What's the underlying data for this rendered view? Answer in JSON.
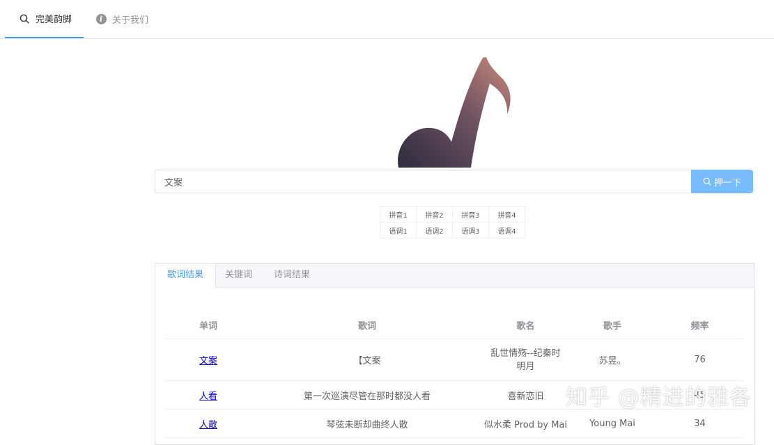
{
  "nav": {
    "items": [
      {
        "label": "完美韵脚",
        "icon": "search-icon"
      },
      {
        "label": "关于我们",
        "icon": "info-icon"
      }
    ],
    "active_index": 0,
    "accent": "#409eff"
  },
  "logo": {
    "icon": "music-note-icon"
  },
  "search": {
    "value": "文案",
    "button_label": "押一下",
    "button_color": "#79bbff"
  },
  "pinyin_grid": {
    "row1": [
      "拼音1",
      "拼音2",
      "拼音3",
      "拼音4"
    ],
    "row2": [
      "语调1",
      "语调2",
      "语调3",
      "语调4"
    ]
  },
  "tabs": [
    "歌词结果",
    "关键词",
    "诗词结果"
  ],
  "results": {
    "headers": [
      "单词",
      "歌词",
      "歌名",
      "歌手",
      "频率"
    ],
    "rows": [
      {
        "word": "文案",
        "lyric": "【文案",
        "song": "乱世情殇--纪秦时明月",
        "singer": "苏昱。",
        "freq": "76"
      },
      {
        "word": "人看",
        "lyric": "第一次巡演尽管在那时都没人看",
        "song": "喜新恋旧",
        "singer": "",
        "freq": "45"
      },
      {
        "word": "人散",
        "lyric": "琴弦未断却曲终人散",
        "song": "似水柔 Prod by Mai",
        "singer": "Young Mai",
        "freq": "34"
      }
    ]
  },
  "watermark": "知乎 @精进的雅各"
}
